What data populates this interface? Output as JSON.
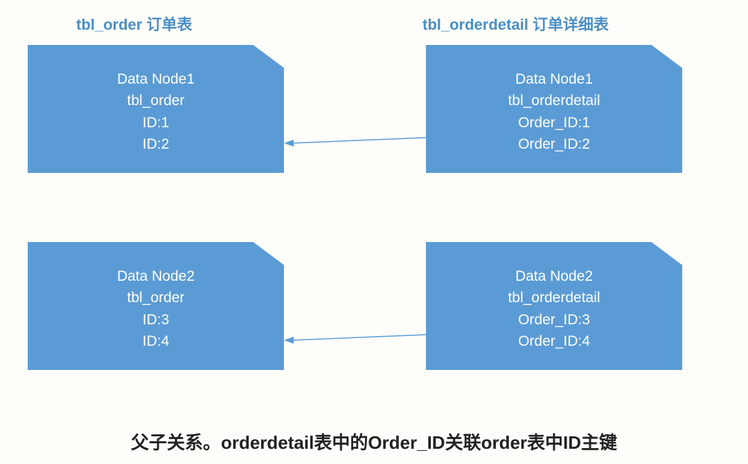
{
  "headers": {
    "left": "tbl_order 订单表",
    "right": "tbl_orderdetail 订单详细表"
  },
  "nodes": {
    "tl": {
      "title": "Data Node1",
      "table": "tbl_order",
      "line3": "ID:1",
      "line4": "ID:2"
    },
    "tr": {
      "title": "Data Node1",
      "table": "tbl_orderdetail",
      "line3": "Order_ID:1",
      "line4": "Order_ID:2"
    },
    "bl": {
      "title": "Data Node2",
      "table": "tbl_order",
      "line3": "ID:3",
      "line4": "ID:4"
    },
    "br": {
      "title": "Data Node2",
      "table": "tbl_orderdetail",
      "line3": "Order_ID:3",
      "line4": "Order_ID:4"
    }
  },
  "caption": "父子关系。orderdetail表中的Order_ID关联order表中ID主键",
  "colors": {
    "node_fill": "#5b9bd5",
    "header_text": "#4a8fc4",
    "arrow": "#5b9bd5"
  }
}
